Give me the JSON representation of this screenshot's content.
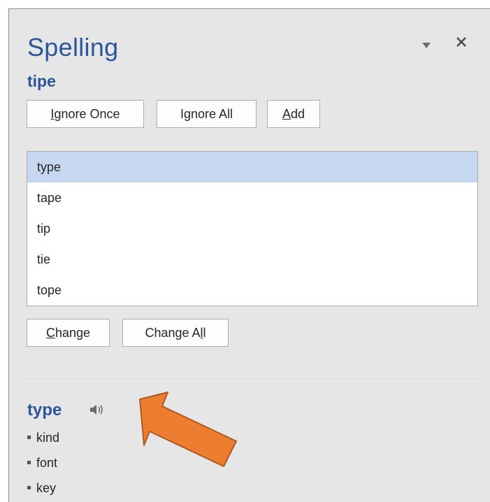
{
  "pane": {
    "title": "Spelling",
    "misspelled_word": "tipe"
  },
  "buttons": {
    "ignore_once": {
      "pre": "",
      "ul": "I",
      "post": "gnore Once"
    },
    "ignore_all": {
      "pre": "I",
      "ul": "g",
      "post": "nore All"
    },
    "add": {
      "pre": "",
      "ul": "A",
      "post": "dd"
    },
    "change": {
      "pre": "",
      "ul": "C",
      "post": "hange"
    },
    "change_all": {
      "pre": "Change A",
      "ul": "l",
      "post": "l"
    }
  },
  "suggestions": [
    "type",
    "tape",
    "tip",
    "tie",
    "tope"
  ],
  "definition": {
    "word": "type",
    "synonyms": [
      "kind",
      "font",
      "key"
    ]
  },
  "icons": {
    "dropdown": "chevron-down-icon",
    "close": "close-icon",
    "speaker": "speaker-icon",
    "annotation": "arrow-annotation"
  },
  "colors": {
    "accent": "#2b579a",
    "selection": "#c5d8f0",
    "arrow_fill": "#ed7d31",
    "arrow_stroke": "#ae5a21"
  }
}
